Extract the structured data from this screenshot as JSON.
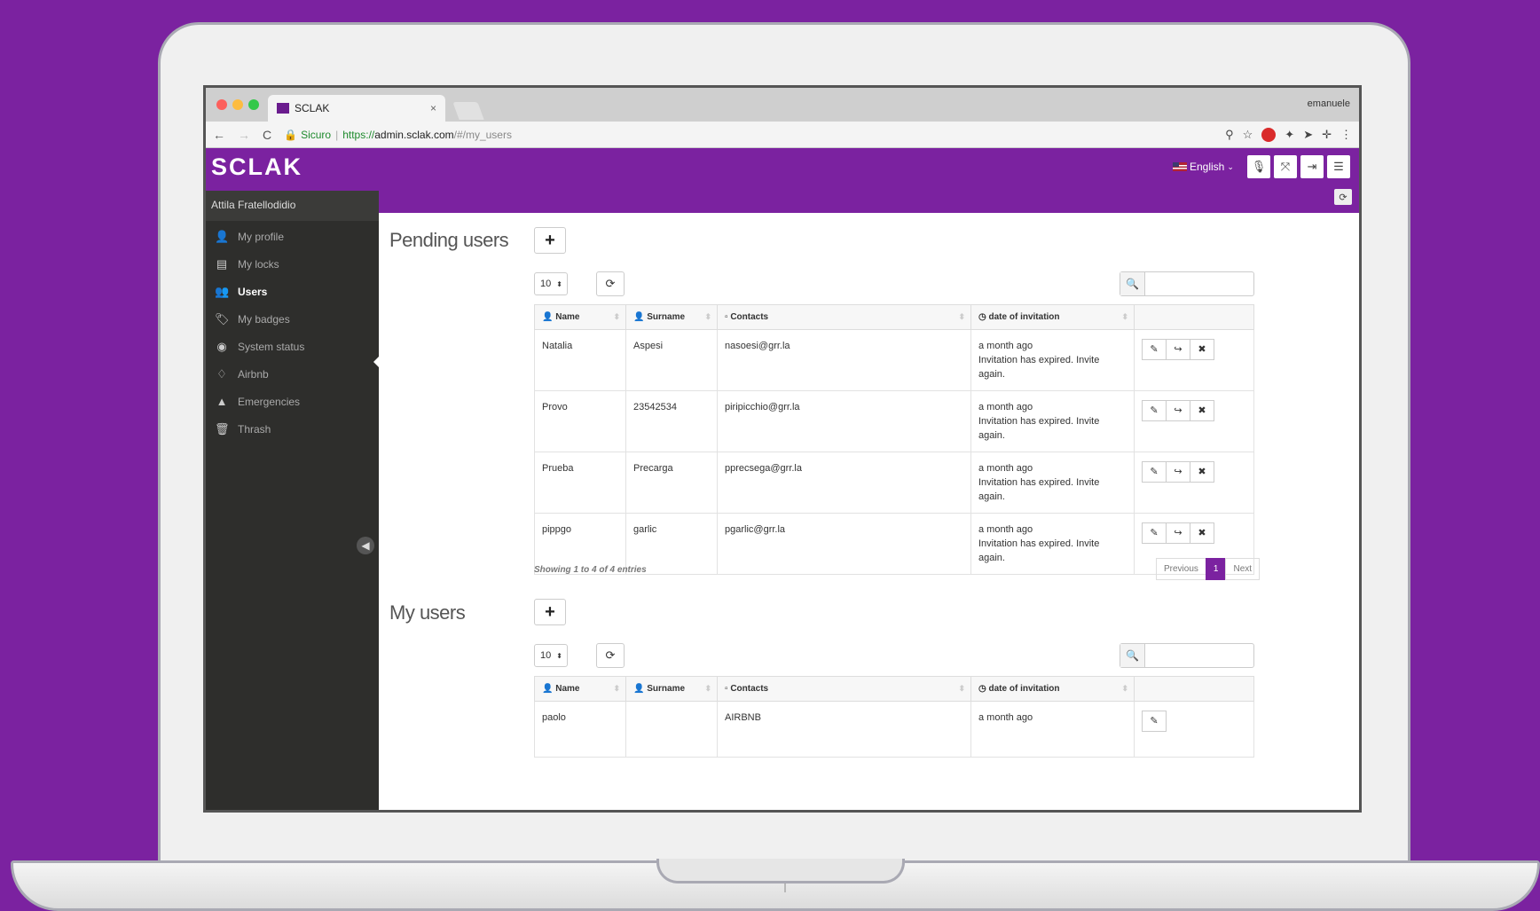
{
  "browser": {
    "tab_title": "SCLAK",
    "tab_close": "×",
    "os_user": "emanuele",
    "secure_label": "Sicuro",
    "url_scheme": "https://",
    "url_host": "admin.sclak.com",
    "url_path": "/#/my_users"
  },
  "header": {
    "brand": "SCLAK",
    "language": "English"
  },
  "sidebar": {
    "user_name": "Attila Fratellodidio",
    "items": [
      {
        "label": "My profile",
        "icon": "user-icon",
        "glyph": "👤"
      },
      {
        "label": "My locks",
        "icon": "lock-list-icon",
        "glyph": "▤"
      },
      {
        "label": "Users",
        "icon": "users-icon",
        "glyph": "👥",
        "active": true
      },
      {
        "label": "My badges",
        "icon": "tags-icon",
        "glyph": "🏷"
      },
      {
        "label": "System status",
        "icon": "globe-icon",
        "glyph": "◉"
      },
      {
        "label": "Airbnb",
        "icon": "airbnb-icon",
        "glyph": "♢"
      },
      {
        "label": "Emergencies",
        "icon": "warning-icon",
        "glyph": "▲"
      },
      {
        "label": "Thrash",
        "icon": "trash-icon",
        "glyph": "🗑"
      }
    ]
  },
  "pending": {
    "title": "Pending users",
    "page_size": "10",
    "columns": [
      "Name",
      "Surname",
      "Contacts",
      "date of invitation"
    ],
    "rows": [
      {
        "name": "Natalia",
        "surname": "Aspesi",
        "contact": "nasoesi@grr.la",
        "date": "a month ago",
        "note": "Invitation has expired. Invite again."
      },
      {
        "name": "Provo",
        "surname": "23542534",
        "contact": "piripicchio@grr.la",
        "date": "a month ago",
        "note": "Invitation has expired. Invite again."
      },
      {
        "name": "Prueba",
        "surname": "Precarga",
        "contact": "pprecsega@grr.la",
        "date": "a month ago",
        "note": "Invitation has expired. Invite again."
      },
      {
        "name": "pippgo",
        "surname": "garlic",
        "contact": "pgarlic@grr.la",
        "date": "a month ago",
        "note": "Invitation has expired. Invite again."
      }
    ],
    "showing": "Showing 1 to 4 of 4 entries",
    "pager": {
      "prev": "Previous",
      "current": "1",
      "next": "Next"
    }
  },
  "my_users": {
    "title": "My users",
    "page_size": "10",
    "columns": [
      "Name",
      "Surname",
      "Contacts",
      "date of invitation"
    ],
    "rows": [
      {
        "name": "paolo",
        "surname": "",
        "contact": "AIRBNB",
        "date": "a month ago"
      }
    ]
  },
  "colors": {
    "brand": "#7b22a0",
    "sidebar": "#2e2e2c"
  }
}
